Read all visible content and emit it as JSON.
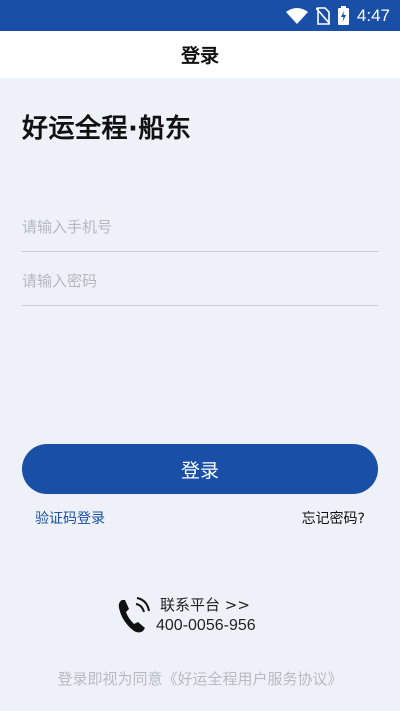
{
  "status_bar": {
    "time": "4:47",
    "icons": [
      "wifi-icon",
      "no-sim-icon",
      "battery-charging-icon"
    ]
  },
  "header": {
    "title": "登录"
  },
  "app": {
    "name": "好运全程·船东"
  },
  "form": {
    "phone_placeholder": "请输入手机号",
    "phone_value": "",
    "password_placeholder": "请输入密码",
    "password_value": ""
  },
  "actions": {
    "login_label": "登录",
    "sms_login_label": "验证码登录",
    "forgot_password_label": "忘记密码?"
  },
  "contact": {
    "label": "联系平台 >>",
    "phone": "400-0056-956"
  },
  "footer": {
    "agreement": "登录即视为同意《好运全程用户服务协议》"
  },
  "colors": {
    "primary": "#1a4fa8",
    "background": "#eef2f8",
    "placeholder": "#b3b8c0"
  }
}
